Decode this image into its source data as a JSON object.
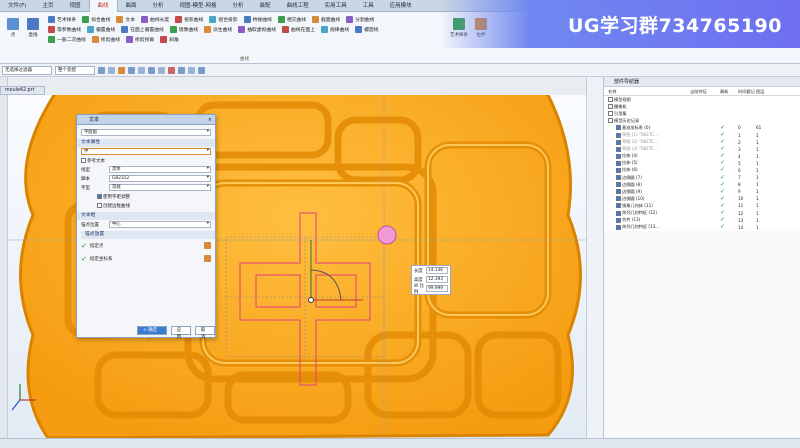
{
  "menu": {
    "tabs": [
      "文件(F)",
      "主页",
      "视图",
      "曲线",
      "曲面",
      "分析",
      "视图-模型-网格",
      "分析",
      "装配",
      "曲线工程",
      "实用工具",
      "工具",
      "应用模块"
    ],
    "active_index": 3
  },
  "ribbon": {
    "big_buttons": [
      "点",
      "直线",
      "艺术样条",
      "拉伸"
    ],
    "items": [
      "艺术样条",
      "拟合曲线",
      "文本",
      "曲线长度",
      "投影曲线",
      "组合投影",
      "桥接曲线",
      "相交曲线",
      "截面曲线",
      "分割曲线",
      "等参数曲线",
      "偏置曲线",
      "在面上偏置曲线",
      "镜像曲线",
      "派生曲线",
      "抽取虚拟曲线",
      "曲线在面上",
      "规律曲线",
      "螺旋线",
      "一般二次曲线",
      "修剪曲线",
      "修剪拐角",
      "斜角"
    ],
    "group_label": "曲线"
  },
  "toolbar": {
    "filter": "整个装配",
    "selection": "无选择过滤器"
  },
  "file_tab": "moule42.prt",
  "brand": "UG学习群734765190",
  "dialog": {
    "title": "文本",
    "type_value": "平面副",
    "section_text_props": "文本属性",
    "text_value": "中",
    "ref_text": "参考文本",
    "rows": [
      {
        "label": "线型",
        "value": "黑体"
      },
      {
        "label": "脚本",
        "value": "GB2312"
      },
      {
        "label": "字型",
        "value": "常规"
      }
    ],
    "opt_kerning": "使用字距调整",
    "opt_curve": "创建边框曲线",
    "section_frame": "文本框",
    "anchor_label": "锚点位置",
    "anchor_value": "中心",
    "subsection": "锚点放置",
    "specify_point": "指定点",
    "specify_csys": "指定坐标系",
    "ok": "< 确定 >",
    "apply": "应用",
    "cancel": "取消"
  },
  "dim_box": {
    "length_label": "长度",
    "length": "14.136",
    "height_label": "高度",
    "height": "12.393",
    "width_label": "W 比例",
    "width": "99.999"
  },
  "navigator": {
    "title": "部件导航器",
    "columns": [
      "名称",
      "当前特征",
      "最新",
      "时间戳记",
      "图层"
    ],
    "rows": [
      {
        "name": "模型视图",
        "cur": "",
        "latest": "",
        "ts": "",
        "layer": ""
      },
      {
        "name": "摄像机",
        "cur": "",
        "latest": "",
        "ts": "",
        "layer": ""
      },
      {
        "name": "引用集",
        "cur": "",
        "latest": "",
        "ts": "",
        "layer": ""
      },
      {
        "name": "模型历史记录",
        "cur": "",
        "latest": "",
        "ts": "",
        "layer": ""
      },
      {
        "name": "基准坐标系 (0)",
        "cur": "",
        "latest": "✓",
        "ts": "0",
        "layer": "61"
      },
      {
        "name": "草图 (1) \"SKETC...",
        "cur": "",
        "latest": "✓",
        "ts": "1",
        "layer": "1"
      },
      {
        "name": "草图 (2) \"SKETC...",
        "cur": "",
        "latest": "✓",
        "ts": "2",
        "layer": "1"
      },
      {
        "name": "草图 (3) \"SKETC...",
        "cur": "",
        "latest": "✓",
        "ts": "3",
        "layer": "1"
      },
      {
        "name": "拉伸 (4)",
        "cur": "",
        "latest": "✓",
        "ts": "4",
        "layer": "1"
      },
      {
        "name": "拉伸 (5)",
        "cur": "",
        "latest": "✓",
        "ts": "5",
        "layer": "1"
      },
      {
        "name": "拉伸 (6)",
        "cur": "",
        "latest": "✓",
        "ts": "6",
        "layer": "1"
      },
      {
        "name": "边倒圆 (7)",
        "cur": "",
        "latest": "✓",
        "ts": "7",
        "layer": "1"
      },
      {
        "name": "边倒圆 (8)",
        "cur": "",
        "latest": "✓",
        "ts": "8",
        "layer": "1"
      },
      {
        "name": "边倒圆 (9)",
        "cur": "",
        "latest": "✓",
        "ts": "9",
        "layer": "1"
      },
      {
        "name": "边倒圆 (10)",
        "cur": "",
        "latest": "✓",
        "ts": "10",
        "layer": "1"
      },
      {
        "name": "镜像几何体 (11)",
        "cur": "",
        "latest": "✓",
        "ts": "11",
        "layer": "1"
      },
      {
        "name": "阵列几何特征 (12)",
        "cur": "",
        "latest": "✓",
        "ts": "12",
        "layer": "1"
      },
      {
        "name": "合并 (13)",
        "cur": "",
        "latest": "✓",
        "ts": "13",
        "layer": "1"
      },
      {
        "name": "阵列几何特征 [13...",
        "cur": "",
        "latest": "✓",
        "ts": "14",
        "layer": "1"
      }
    ]
  },
  "colors": {
    "cake": "#f7a81a",
    "cake_dark": "#d98400",
    "sketch": "#e0407a",
    "accent": "#b33333"
  }
}
